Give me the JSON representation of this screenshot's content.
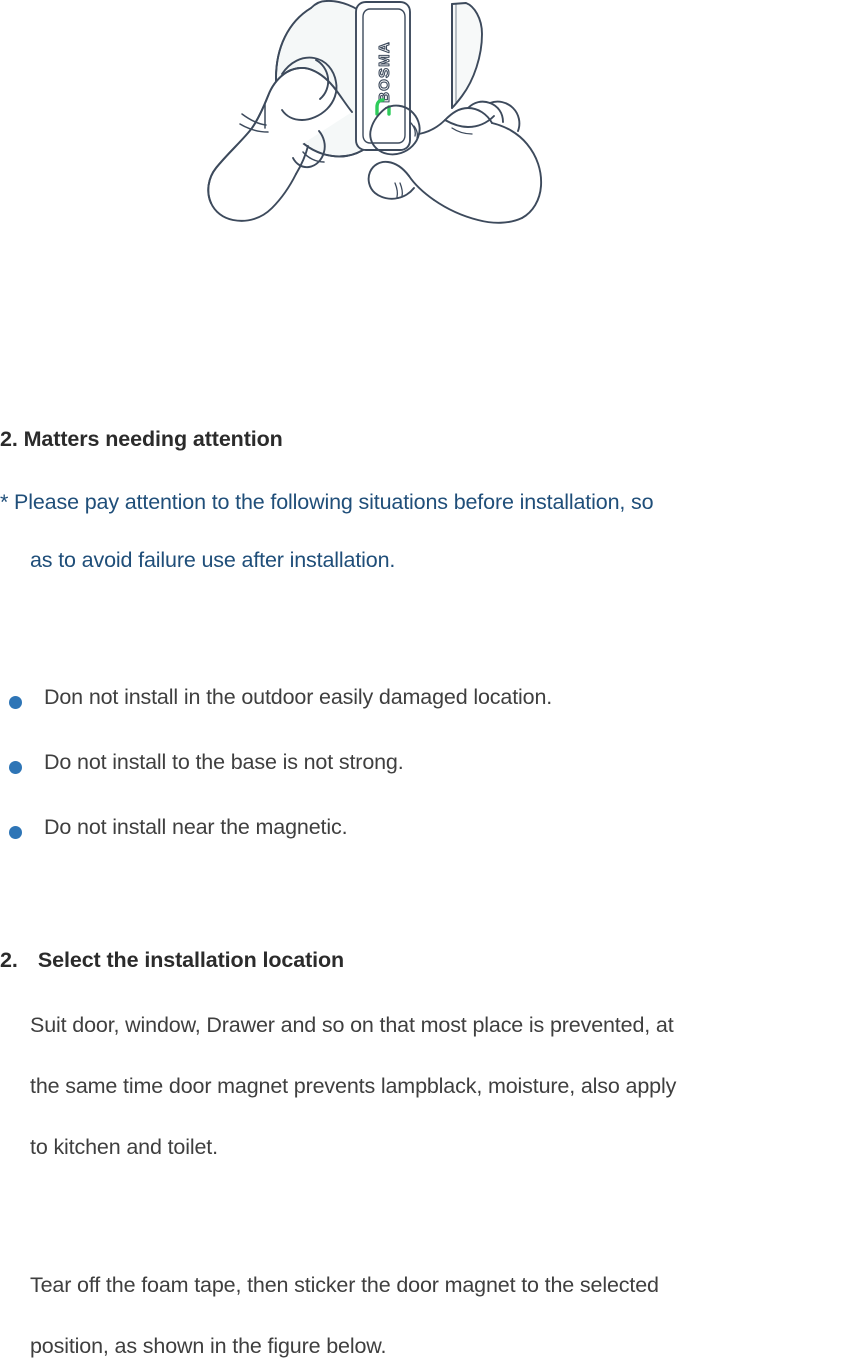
{
  "page": {
    "background_color": "#ffffff",
    "text_color": "#3f3f3f",
    "heading_color": "#2b2b2b",
    "accent_blue": "#1f4e79",
    "bullet_color": "#2e75b6",
    "line_art_color": "#3d4a5c",
    "led_color": "#2ecc5a"
  },
  "illustration": {
    "name": "two-hands-pairing-door-sensor",
    "description": "Line drawing of a left hand holding a BOSMA door sensor while a right hand presses the sensor button and holds the magnet piece",
    "device_brand": "BOSMA",
    "led_label": "status-led-green"
  },
  "sections": {
    "attention": {
      "heading_number": "2.",
      "heading_text": "Matters needing attention",
      "note_lines": [
        "* Please pay attention to the following situations before installation, so",
        "as to avoid failure use after installation."
      ],
      "bullets": [
        "Don not install in the outdoor easily damaged location.",
        "Do not install to the base is not strong.",
        "Do not install near the magnetic."
      ]
    },
    "location": {
      "heading_number": "2.",
      "heading_text": "Select the installation location",
      "paragraph_one_lines": [
        "Suit door, window, Drawer and so on that most place is prevented, at",
        "the same time door magnet prevents lampblack, moisture, also apply",
        "to kitchen and toilet."
      ],
      "paragraph_two_lines": [
        "Tear off the foam tape, then sticker the door magnet to the selected",
        "position, as shown in the figure below."
      ]
    }
  }
}
